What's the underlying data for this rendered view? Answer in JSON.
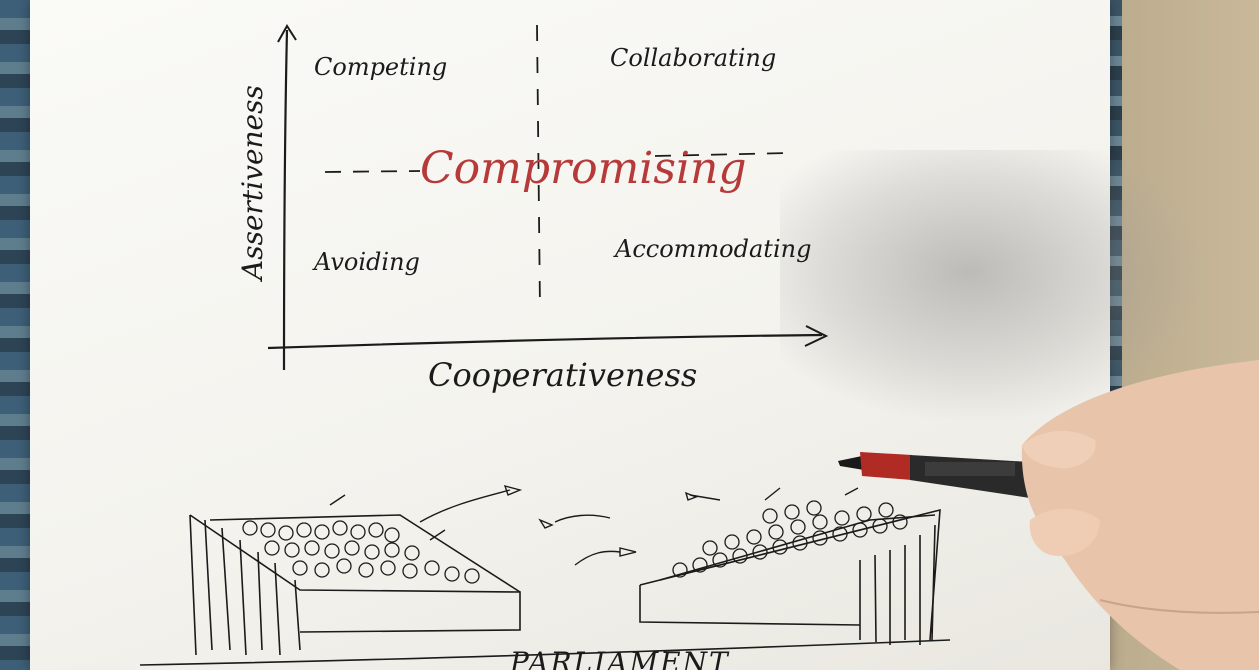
{
  "quadrants": {
    "top_left": "Competing",
    "top_right": "Collaborating",
    "bottom_left": "Avoiding",
    "bottom_right": "Accommodating",
    "center": "Compromising"
  },
  "axes": {
    "y_label": "Assertiveness",
    "x_label": "Cooperativeness"
  },
  "sketch": {
    "caption": "PARLIAMENT"
  },
  "colors": {
    "ink": "#1b1b1b",
    "red_ink": "#b73a3a",
    "paper": "#f6f5f1"
  },
  "icons": {
    "pen": "pen-icon",
    "hand": "hand-icon"
  }
}
